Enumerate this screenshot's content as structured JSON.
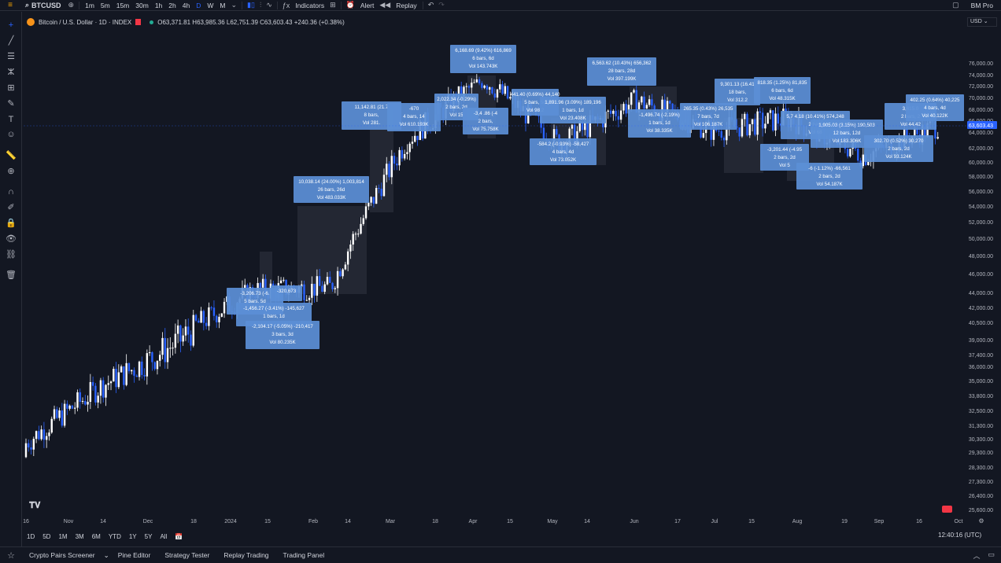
{
  "toolbar": {
    "symbol": "BTCUSD",
    "intervals": [
      "1m",
      "5m",
      "15m",
      "30m",
      "1h",
      "2h",
      "4h",
      "D",
      "W",
      "M"
    ],
    "active_interval": "D",
    "indicators_label": "Indicators",
    "alert_label": "Alert",
    "replay_label": "Replay",
    "account_label": "BM Pro"
  },
  "legend": {
    "title": "Bitcoin / U.S. Dollar · 1D · INDEX",
    "ohlc": "O63,371.81 H63,985.36 L62,751.39 C63,603.43 +240.36 (+0.38%)"
  },
  "currency": "USD",
  "price_axis": {
    "labels": [
      "76,000.00",
      "74,000.00",
      "72,000.00",
      "70,000.00",
      "68,000.00",
      "66,000.00",
      "64,000.00",
      "62,000.00",
      "60,000.00",
      "58,000.00",
      "56,000.00",
      "54,000.00",
      "52,000.00",
      "50,000.00",
      "48,000.00",
      "46,000.00",
      "44,000.00",
      "42,000.00",
      "40,500.00",
      "39,000.00",
      "37,400.00",
      "36,000.00",
      "35,000.00",
      "33,800.00",
      "32,500.00",
      "31,300.00",
      "30,300.00",
      "29,300.00",
      "28,300.00",
      "27,300.00",
      "26,400.00",
      "25,600.00"
    ],
    "current_price_label": "63,603.43"
  },
  "time_axis": {
    "labels": [
      "16",
      "Nov",
      "14",
      "Dec",
      "18",
      "2024",
      "15",
      "Feb",
      "14",
      "Mar",
      "18",
      "Apr",
      "15",
      "May",
      "14",
      "Jun",
      "17",
      "Jul",
      "15",
      "Aug",
      "19",
      "Sep",
      "16",
      "Oct"
    ]
  },
  "range_buttons": [
    "1D",
    "5D",
    "1M",
    "3M",
    "6M",
    "YTD",
    "1Y",
    "5Y",
    "All"
  ],
  "clock": "12:40:16 (UTC)",
  "bottom_tabs": [
    "Crypto Pairs Screener",
    "Pine Editor",
    "Strategy Tester",
    "Replay Trading",
    "Trading Panel"
  ],
  "measure_boxes": [
    {
      "l1": "6,168.69 (9.42%) 616,869",
      "l2": "6 bars, 6d",
      "l3": "Vol 143.743K"
    },
    {
      "l1": "6,563.62 (10.43%) 656,362",
      "l2": "28 bars, 28d",
      "l3": "Vol 397.199K"
    },
    {
      "l1": "11,142.81 (21.7",
      "l2": "8 bars,",
      "l3": "Vol 281."
    },
    {
      "l1": "-670",
      "l2": "4 bars, 14",
      "l3": "Vol 610.193K"
    },
    {
      "l1": "2,022.34 (-0.29%)",
      "l2": "2 bars, 2d",
      "l3": "Vol 15"
    },
    {
      "l1": "-3,4 .86 (-4",
      "l2": "2 bars,",
      "l3": "Vol 75.758K"
    },
    {
      "l1": "441.40 (0.69%) 44,140",
      "l2": "5 bars, 5d",
      "l3": "Vol 98.2"
    },
    {
      "l1": "1,891.96 (3.09%) 189,196",
      "l2": "1 bars, 1d",
      "l3": "Vol 23.408K"
    },
    {
      "l1": "-584.2 (-0.93%) -58,427",
      "l2": "4 bars, 4d",
      "l3": "Vol 73.052K"
    },
    {
      "l1": "-1,496.74 (-2.19%)",
      "l2": "1 bars, 1d",
      "l3": "Vol 38.335K"
    },
    {
      "l1": "265.35 (0.43%) 26,535",
      "l2": "7 bars, 7d",
      "l3": "Vol 106.187K"
    },
    {
      "l1": "9,301.13 (16.41",
      "l2": "18 bars,",
      "l3": "Vol 312.2"
    },
    {
      "l1": "818.35 (1.25%) 81,835",
      "l2": "6 bars, 6d",
      "l3": "Vol 48.315K"
    },
    {
      "l1": "5,7 4.18 (10.41%) 574,248",
      "l2": "2 bars",
      "l3": "Vol 68"
    },
    {
      "l1": "1,905.03 (3.15%) 190,503",
      "l2": "12 bars, 12d",
      "l3": "Vol 183.306K"
    },
    {
      "l1": "-3,201.44 (-4.95",
      "l2": "2 bars, 2d",
      "l3": "Vol 5"
    },
    {
      "l1": "-6 (-1.12%) -66,561",
      "l2": "2 bars, 2d",
      "l3": "Vol 54.187K"
    },
    {
      "l1": "3,615.0",
      "l2": "2 bars, 2",
      "l3": "Vol 44.42"
    },
    {
      "l1": "402.25 (0.64%) 40,225",
      "l2": "4 bars, 4d",
      "l3": "Vol 40.122K"
    },
    {
      "l1": "302.70 (0.52%) 30,270",
      "l2": "2 bars, 2d",
      "l3": "Vol 93.124K"
    },
    {
      "l1": "10,038.14 (24.00%) 1,003,814",
      "l2": "26 bars, 26d",
      "l3": "Vol 483.033K"
    },
    {
      "l1": "-3,206.73 (-6.",
      "l2": "5 bars, 5d",
      "l3": ""
    },
    {
      "l1": "-1,456.27 (-3.41%) -145,627",
      "l2": "1 bars, 1d",
      "l3": ""
    },
    {
      "l1": "-2,104.17 (-5.05%) -210,417",
      "l2": "3 bars, 3d",
      "l3": "Vol 80.235K"
    },
    {
      "l1": "-320,673",
      "l2": "",
      "l3": ""
    }
  ],
  "chart_data": {
    "type": "candlestick",
    "symbol": "BTCUSD",
    "timeframe": "1D",
    "ylim": [
      25600,
      76000
    ],
    "last_price": 63603.43,
    "monthly_closes": [
      {
        "month": "Oct 2023",
        "close": 34500
      },
      {
        "month": "Nov 2023",
        "close": 37700
      },
      {
        "month": "Dec 2023",
        "close": 42300
      },
      {
        "month": "Jan 2024",
        "close": 42600
      },
      {
        "month": "Feb 2024",
        "close": 61200
      },
      {
        "month": "Mar 2024",
        "close": 71300
      },
      {
        "month": "Apr 2024",
        "close": 60700
      },
      {
        "month": "May 2024",
        "close": 67500
      },
      {
        "month": "Jun 2024",
        "close": 62700
      },
      {
        "month": "Jul 2024",
        "close": 64600
      },
      {
        "month": "Aug 2024",
        "close": 58900
      },
      {
        "month": "Sep 2024",
        "close": 63600
      }
    ]
  }
}
